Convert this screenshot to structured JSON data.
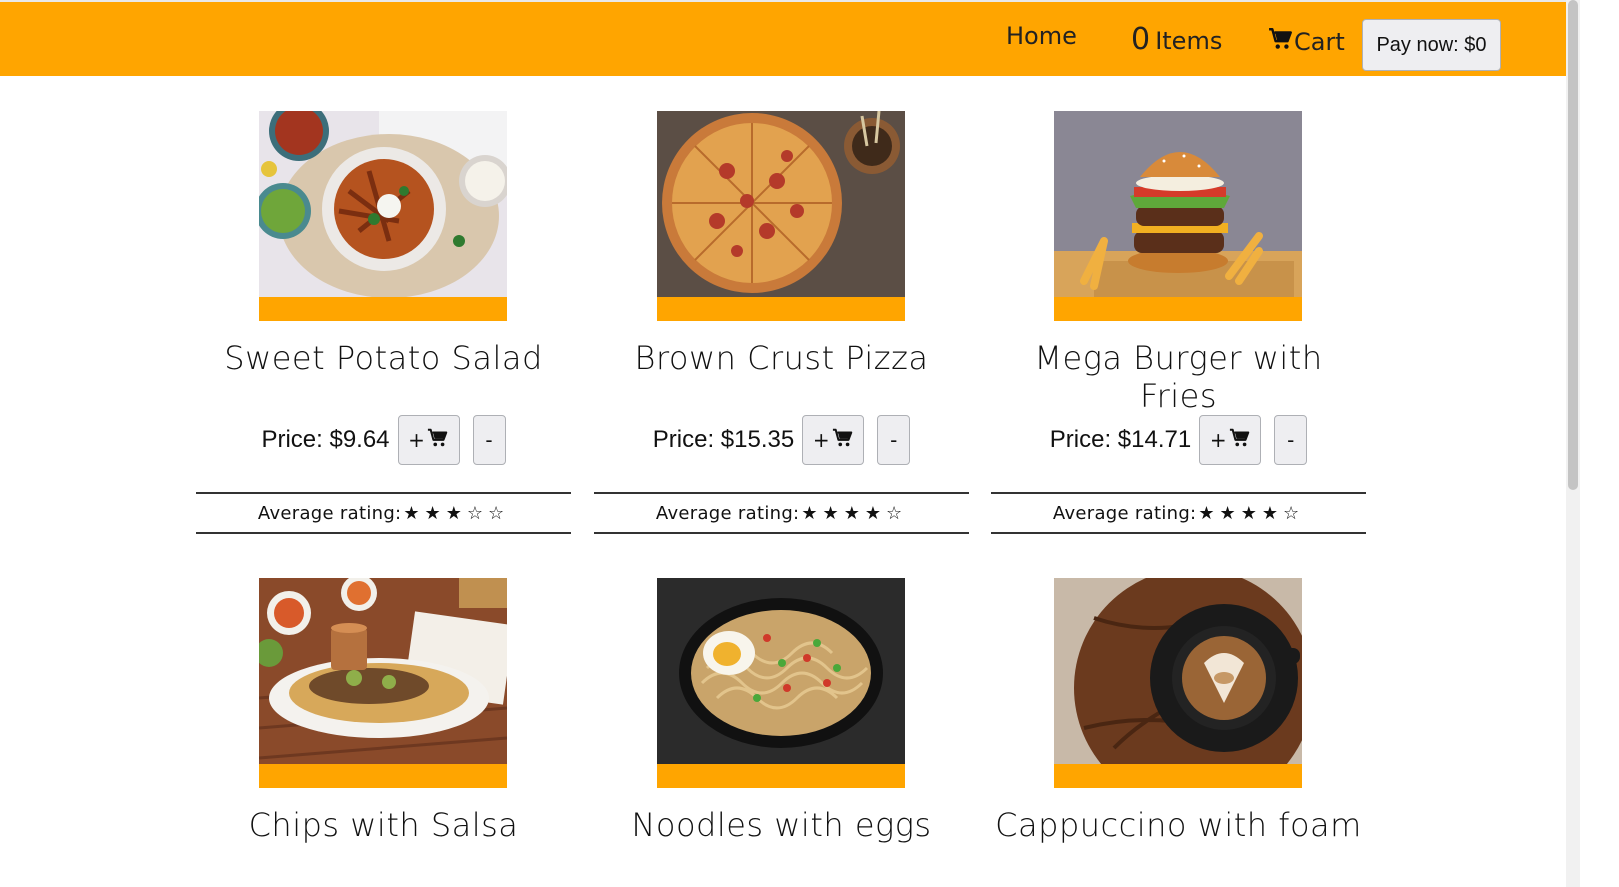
{
  "nav": {
    "home": "Home",
    "items_count": "0",
    "items_label": "Items",
    "cart": "Cart",
    "pay": "Pay now: $0",
    "bg_color": "#ffa500"
  },
  "products": [
    {
      "name": "Sweet Potato Salad",
      "price": "Price: $9.64",
      "add": "+",
      "remove": "-",
      "rating_label": "Average rating:",
      "stars": "★★★☆☆",
      "rating": 3
    },
    {
      "name": "Brown Crust Pizza",
      "price": "Price: $15.35",
      "add": "+",
      "remove": "-",
      "rating_label": "Average rating:",
      "stars": "★★★★☆",
      "rating": 4
    },
    {
      "name": "Mega Burger with Fries",
      "price": "Price: $14.71",
      "add": "+",
      "remove": "-",
      "rating_label": "Average rating:",
      "stars": "★★★★☆",
      "rating": 4
    },
    {
      "name": "Chips with Salsa"
    },
    {
      "name": "Noodles with eggs"
    },
    {
      "name": "Cappuccino with foam"
    }
  ]
}
